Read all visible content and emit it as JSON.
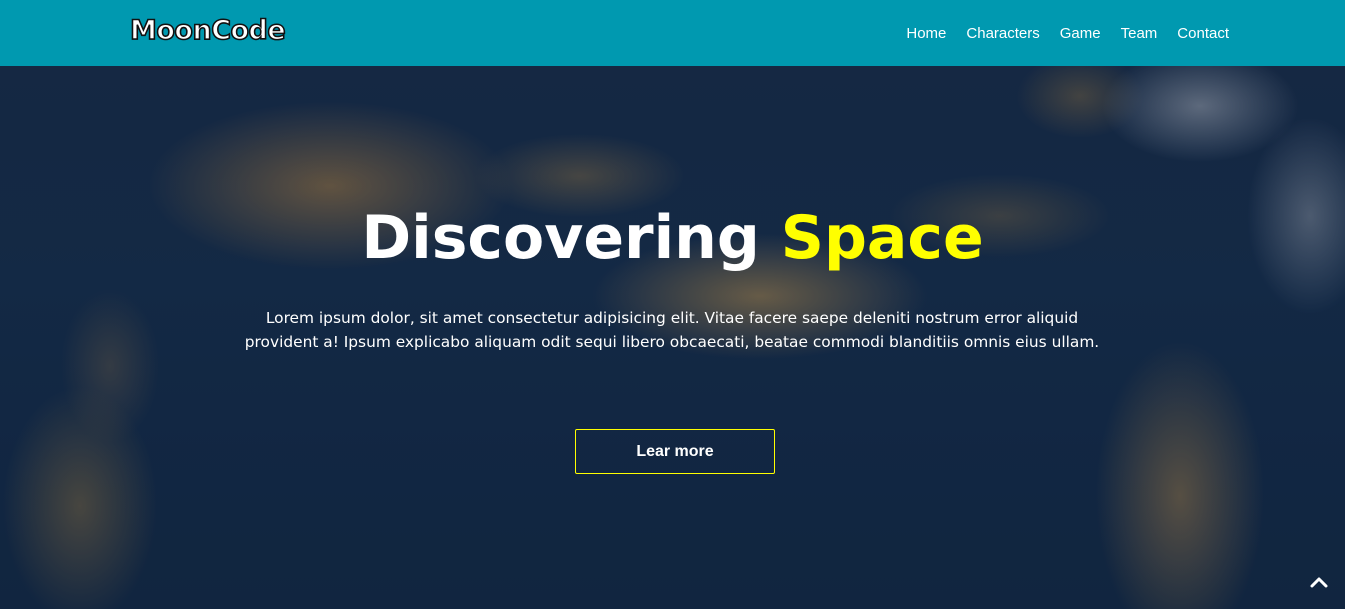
{
  "brand": {
    "logo_text": "MoonCode"
  },
  "nav": {
    "items": [
      {
        "label": "Home"
      },
      {
        "label": "Characters"
      },
      {
        "label": "Game"
      },
      {
        "label": "Team"
      },
      {
        "label": "Contact"
      }
    ]
  },
  "hero": {
    "title_main": "Discovering",
    "title_accent": "Space",
    "description": "Lorem ipsum dolor, sit amet consectetur adipisicing elit. Vitae facere saepe deleniti nostrum error aliquid provident a! Ipsum explicabo aliquam odit sequi libero obcaecati, beatae commodi blanditiis omnis eius ullam.",
    "cta_label": "Lear more"
  },
  "icons": {
    "scroll_top": "chevron-up-icon"
  },
  "colors": {
    "navbar_bg": "#0099b0",
    "accent": "#ffff00",
    "text": "#ffffff"
  }
}
